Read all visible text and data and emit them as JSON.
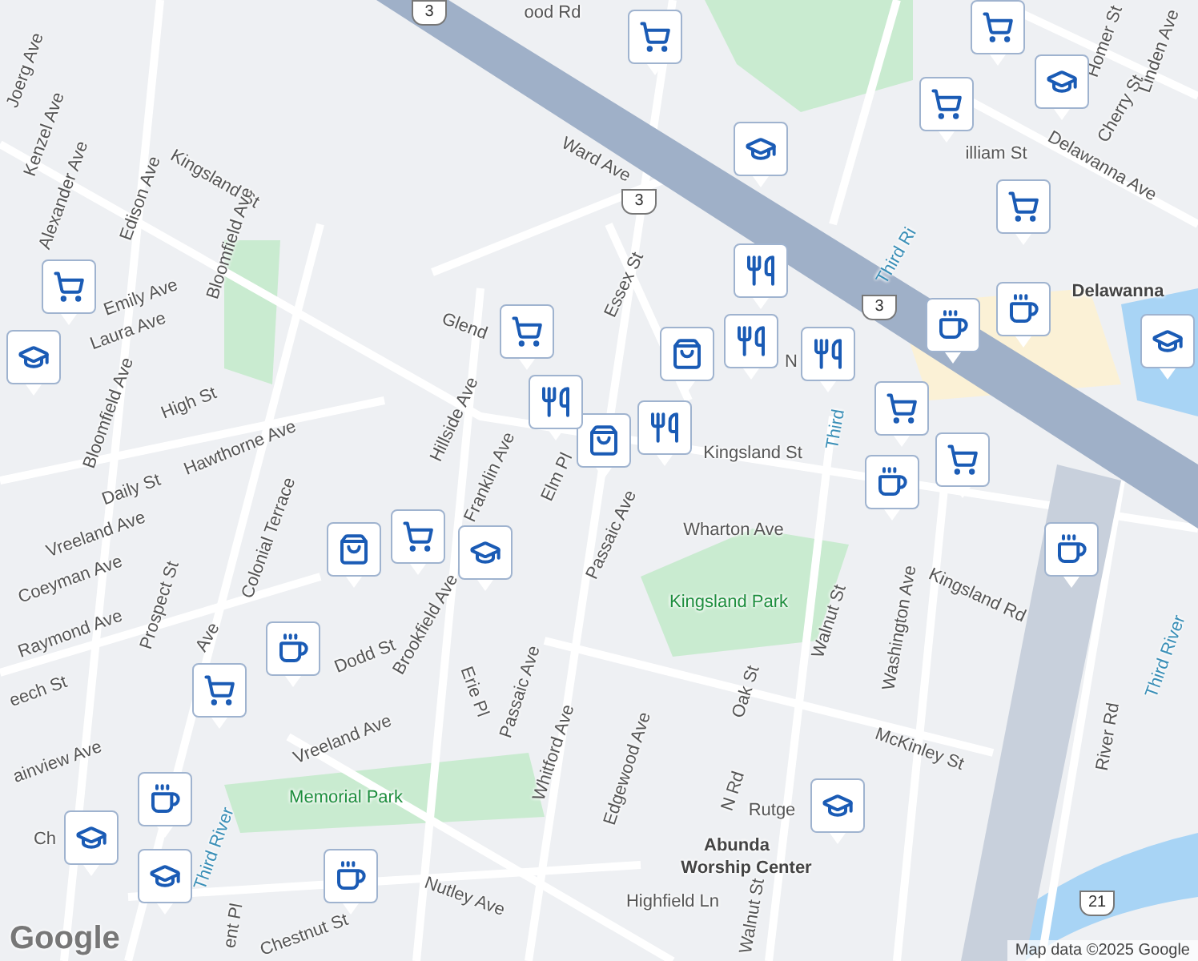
{
  "labels": [
    {
      "text": "ood Rd",
      "kind": "street"
    },
    {
      "text": "Joerg Ave",
      "kind": "street"
    },
    {
      "text": "Kenzel Ave",
      "kind": "street"
    },
    {
      "text": "Alexander Ave",
      "kind": "street"
    },
    {
      "text": "Edison Ave",
      "kind": "street"
    },
    {
      "text": "Kingsland St",
      "kind": "street"
    },
    {
      "text": "Bloomfield Ave",
      "kind": "street"
    },
    {
      "text": "Emily Ave",
      "kind": "street"
    },
    {
      "text": "Laura Ave",
      "kind": "street"
    },
    {
      "text": "Bloomfield Ave",
      "kind": "street"
    },
    {
      "text": "High St",
      "kind": "street"
    },
    {
      "text": "Hawthorne Ave",
      "kind": "street"
    },
    {
      "text": "Daily St",
      "kind": "street"
    },
    {
      "text": "Vreeland Ave",
      "kind": "street"
    },
    {
      "text": "Colonial Terrace",
      "kind": "street"
    },
    {
      "text": "Coeyman Ave",
      "kind": "street"
    },
    {
      "text": "Prospect St",
      "kind": "street"
    },
    {
      "text": "Raymond Ave",
      "kind": "street"
    },
    {
      "text": "Ave",
      "kind": "street"
    },
    {
      "text": "eech St",
      "kind": "street"
    },
    {
      "text": "ainview Ave",
      "kind": "street"
    },
    {
      "text": "Dodd St",
      "kind": "street"
    },
    {
      "text": "Vreeland Ave",
      "kind": "street"
    },
    {
      "text": "Brookfield Ave",
      "kind": "street"
    },
    {
      "text": "Hillside Ave",
      "kind": "street"
    },
    {
      "text": "Franklin Ave",
      "kind": "street"
    },
    {
      "text": "Glend",
      "kind": "street"
    },
    {
      "text": "Essex St",
      "kind": "street"
    },
    {
      "text": "Ward Ave",
      "kind": "street"
    },
    {
      "text": "Elm Pl",
      "kind": "street"
    },
    {
      "text": "Passaic Ave",
      "kind": "street"
    },
    {
      "text": "Kingsland St",
      "kind": "street"
    },
    {
      "text": "Wharton Ave",
      "kind": "street"
    },
    {
      "text": "Kingsland Park",
      "kind": "park"
    },
    {
      "text": "Kingsland Rd",
      "kind": "street"
    },
    {
      "text": "Erie Pl",
      "kind": "street"
    },
    {
      "text": "Passaic Ave",
      "kind": "street"
    },
    {
      "text": "Whitford Ave",
      "kind": "street"
    },
    {
      "text": "Edgewood Ave",
      "kind": "street"
    },
    {
      "text": "Oak St",
      "kind": "street"
    },
    {
      "text": "Walnut St",
      "kind": "street"
    },
    {
      "text": "Washington Ave",
      "kind": "street"
    },
    {
      "text": "McKinley St",
      "kind": "street"
    },
    {
      "text": "N Rd",
      "kind": "street"
    },
    {
      "text": "Rutge",
      "kind": "street"
    },
    {
      "text": "Memorial Park",
      "kind": "park"
    },
    {
      "text": "Third River",
      "kind": "water"
    },
    {
      "text": "Ch",
      "kind": "street"
    },
    {
      "text": "Chestnut St",
      "kind": "street"
    },
    {
      "text": "ent Pl",
      "kind": "street"
    },
    {
      "text": "Nutley Ave",
      "kind": "street"
    },
    {
      "text": "Highfield Ln",
      "kind": "street"
    },
    {
      "text": "Walnut St",
      "kind": "street"
    },
    {
      "text": "Abunda",
      "kind": "place"
    },
    {
      "text": "Worship Center",
      "kind": "place"
    },
    {
      "text": "River Rd",
      "kind": "street"
    },
    {
      "text": "Third River",
      "kind": "water"
    },
    {
      "text": "Third",
      "kind": "water"
    },
    {
      "text": "N",
      "kind": "street"
    },
    {
      "text": "Third Ri",
      "kind": "water"
    },
    {
      "text": "Delawanna Ave",
      "kind": "street"
    },
    {
      "text": "Delawanna",
      "kind": "place"
    },
    {
      "text": "Cherry St",
      "kind": "street"
    },
    {
      "text": "Linden Ave",
      "kind": "street"
    },
    {
      "text": "Homer St",
      "kind": "street"
    },
    {
      "text": "illiam St",
      "kind": "street"
    }
  ],
  "shields": [
    {
      "text": "3"
    },
    {
      "text": "3"
    },
    {
      "text": "3"
    },
    {
      "text": "21"
    }
  ],
  "markers": [
    {
      "kind": "grocery"
    },
    {
      "kind": "grocery"
    },
    {
      "kind": "school"
    },
    {
      "kind": "grocery"
    },
    {
      "kind": "school"
    },
    {
      "kind": "grocery"
    },
    {
      "kind": "restaurant"
    },
    {
      "kind": "cafe"
    },
    {
      "kind": "cafe"
    },
    {
      "kind": "school"
    },
    {
      "kind": "shopping"
    },
    {
      "kind": "restaurant"
    },
    {
      "kind": "restaurant"
    },
    {
      "kind": "restaurant"
    },
    {
      "kind": "shopping"
    },
    {
      "kind": "grocery"
    },
    {
      "kind": "cafe"
    },
    {
      "kind": "grocery"
    },
    {
      "kind": "cafe"
    },
    {
      "kind": "grocery"
    },
    {
      "kind": "school"
    },
    {
      "kind": "grocery"
    },
    {
      "kind": "restaurant"
    },
    {
      "kind": "shopping"
    },
    {
      "kind": "grocery"
    },
    {
      "kind": "school"
    },
    {
      "kind": "cafe"
    },
    {
      "kind": "grocery"
    },
    {
      "kind": "cafe"
    },
    {
      "kind": "school"
    },
    {
      "kind": "school"
    },
    {
      "kind": "cafe"
    },
    {
      "kind": "school"
    }
  ],
  "logo": "Google",
  "attribution": "Map data ©2025 Google"
}
